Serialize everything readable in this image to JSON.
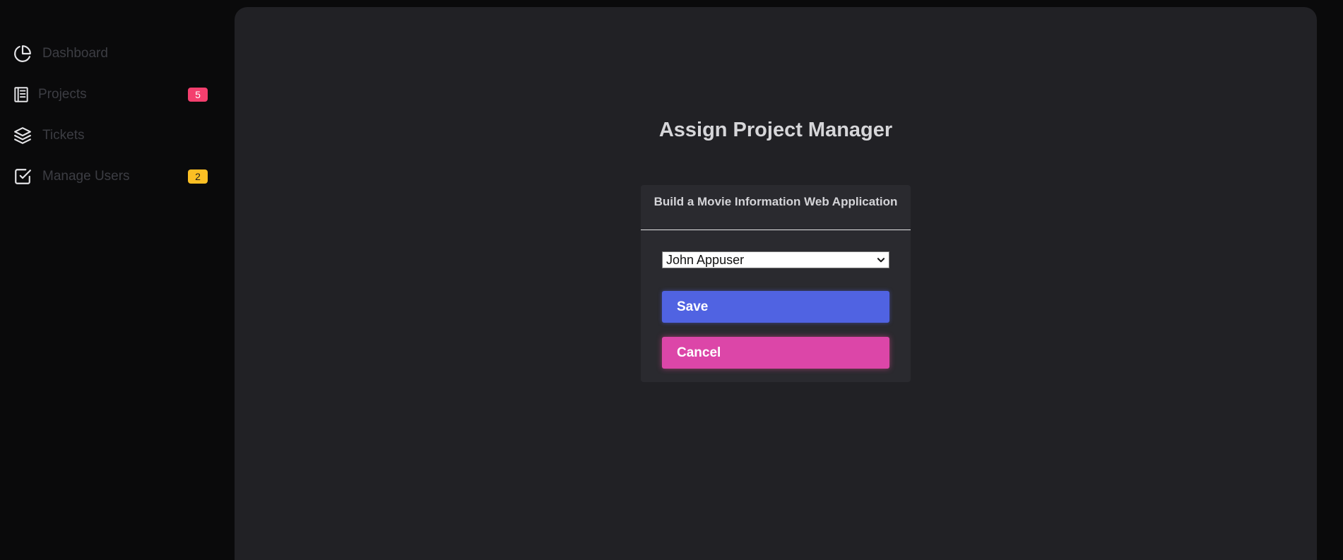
{
  "sidebar": {
    "items": [
      {
        "label": "Dashboard",
        "icon": "pie-chart-icon"
      },
      {
        "label": "Projects",
        "icon": "book-icon",
        "badge": "5"
      },
      {
        "label": "Tickets",
        "icon": "layers-icon"
      },
      {
        "label": "Manage Users",
        "icon": "check-square-icon",
        "badge": "2"
      }
    ]
  },
  "main": {
    "title": "Assign Project Manager",
    "card": {
      "project_name": "Build a Movie Information Web Application",
      "manager_select": {
        "selected": "John Appuser"
      },
      "save_label": "Save",
      "cancel_label": "Cancel"
    }
  },
  "colors": {
    "badge_red": "#f43f6e",
    "badge_yellow": "#fbbf24",
    "save_button": "#5063e2",
    "cancel_button": "#dc46a8",
    "panel_bg": "#212125",
    "card_bg": "#2a2a2f"
  }
}
